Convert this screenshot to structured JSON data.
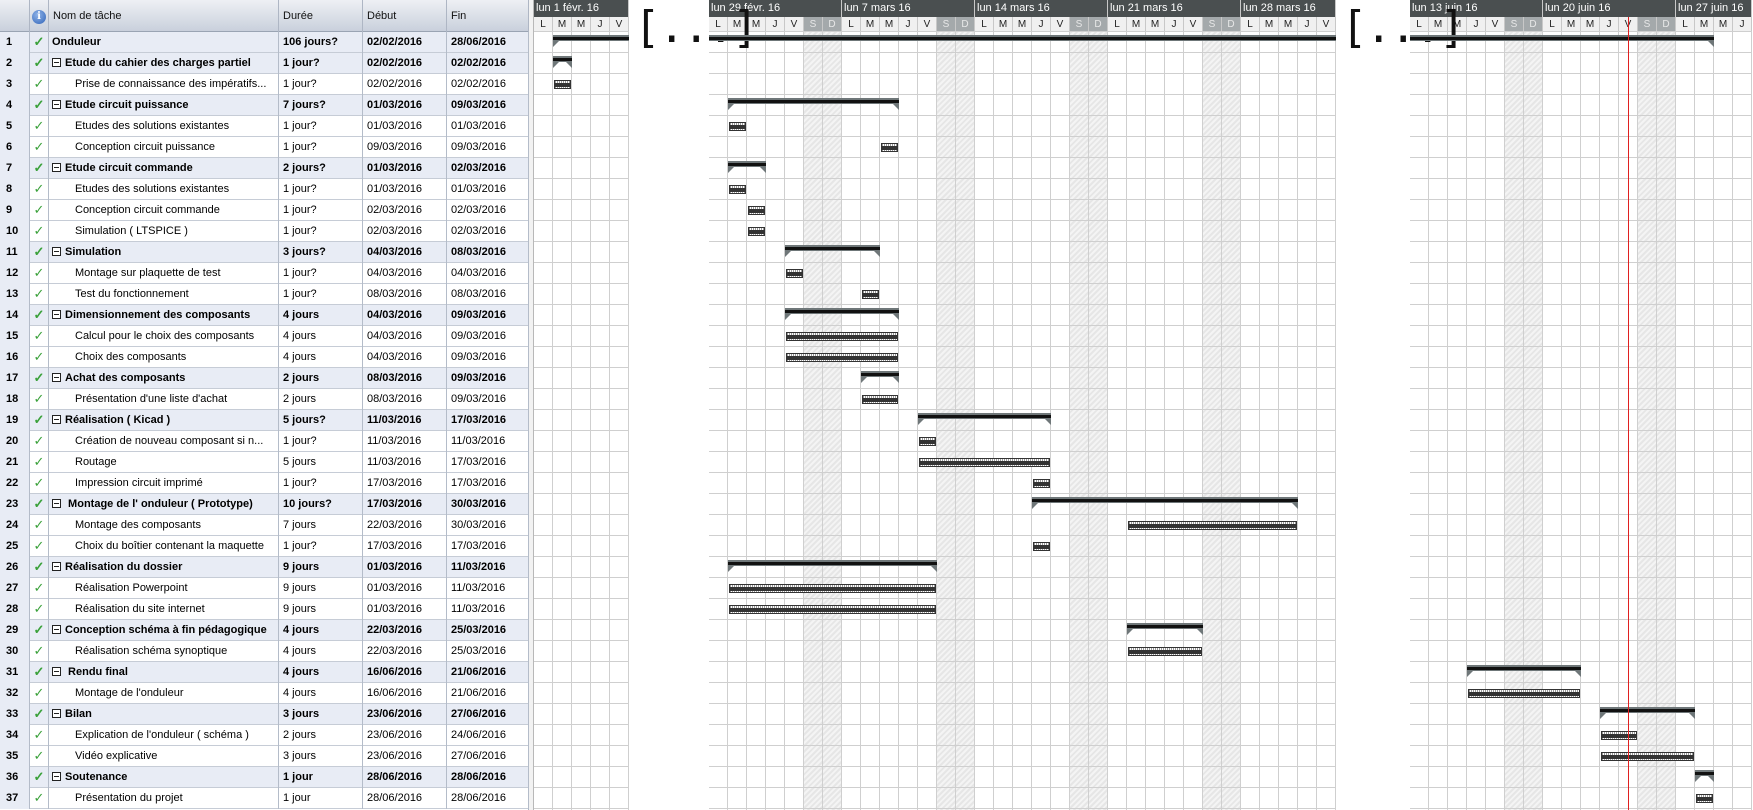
{
  "table": {
    "headers": {
      "id": "",
      "info_icon": "i",
      "name": "Nom de tâche",
      "duration": "Durée",
      "start": "Début",
      "end": "Fin"
    },
    "rows": [
      {
        "id": "1",
        "name": "Onduleur",
        "duration": "106 jours?",
        "start": "02/02/2016",
        "end": "28/06/2016",
        "summary": true,
        "level": 0,
        "collapsible": false,
        "done": true
      },
      {
        "id": "2",
        "name": "Etude du cahier des charges partiel",
        "duration": "1 jour?",
        "start": "02/02/2016",
        "end": "02/02/2016",
        "summary": true,
        "level": 1,
        "collapsible": true,
        "done": true
      },
      {
        "id": "3",
        "name": "Prise de connaissance des impératifs...",
        "duration": "1 jour?",
        "start": "02/02/2016",
        "end": "02/02/2016",
        "summary": false,
        "level": 2,
        "done": true
      },
      {
        "id": "4",
        "name": "Etude circuit puissance",
        "duration": "7 jours?",
        "start": "01/03/2016",
        "end": "09/03/2016",
        "summary": true,
        "level": 1,
        "collapsible": true,
        "done": true
      },
      {
        "id": "5",
        "name": "Etudes des solutions existantes",
        "duration": "1 jour?",
        "start": "01/03/2016",
        "end": "01/03/2016",
        "summary": false,
        "level": 2,
        "done": true
      },
      {
        "id": "6",
        "name": "Conception circuit puissance",
        "duration": "1 jour?",
        "start": "09/03/2016",
        "end": "09/03/2016",
        "summary": false,
        "level": 2,
        "done": true
      },
      {
        "id": "7",
        "name": "Etude circuit commande",
        "duration": "2 jours?",
        "start": "01/03/2016",
        "end": "02/03/2016",
        "summary": true,
        "level": 1,
        "collapsible": true,
        "done": true
      },
      {
        "id": "8",
        "name": "Etudes des solutions existantes",
        "duration": "1 jour?",
        "start": "01/03/2016",
        "end": "01/03/2016",
        "summary": false,
        "level": 2,
        "done": true
      },
      {
        "id": "9",
        "name": "Conception circuit commande",
        "duration": "1 jour?",
        "start": "02/03/2016",
        "end": "02/03/2016",
        "summary": false,
        "level": 2,
        "done": true
      },
      {
        "id": "10",
        "name": "Simulation ( LTSPICE )",
        "duration": "1 jour?",
        "start": "02/03/2016",
        "end": "02/03/2016",
        "summary": false,
        "level": 2,
        "done": true
      },
      {
        "id": "11",
        "name": "Simulation",
        "duration": "3 jours?",
        "start": "04/03/2016",
        "end": "08/03/2016",
        "summary": true,
        "level": 1,
        "collapsible": true,
        "done": true
      },
      {
        "id": "12",
        "name": "Montage sur plaquette de test",
        "duration": "1 jour?",
        "start": "04/03/2016",
        "end": "04/03/2016",
        "summary": false,
        "level": 2,
        "done": true
      },
      {
        "id": "13",
        "name": "Test du fonctionnement",
        "duration": "1 jour?",
        "start": "08/03/2016",
        "end": "08/03/2016",
        "summary": false,
        "level": 2,
        "done": true
      },
      {
        "id": "14",
        "name": "Dimensionnement des composants",
        "duration": "4 jours",
        "start": "04/03/2016",
        "end": "09/03/2016",
        "summary": true,
        "level": 1,
        "collapsible": true,
        "done": true
      },
      {
        "id": "15",
        "name": "Calcul pour le choix des composants",
        "duration": "4 jours",
        "start": "04/03/2016",
        "end": "09/03/2016",
        "summary": false,
        "level": 2,
        "done": true
      },
      {
        "id": "16",
        "name": "Choix des composants",
        "duration": "4 jours",
        "start": "04/03/2016",
        "end": "09/03/2016",
        "summary": false,
        "level": 2,
        "done": true
      },
      {
        "id": "17",
        "name": "Achat des composants",
        "duration": "2 jours",
        "start": "08/03/2016",
        "end": "09/03/2016",
        "summary": true,
        "level": 1,
        "collapsible": true,
        "done": true
      },
      {
        "id": "18",
        "name": "Présentation d'une liste d'achat",
        "duration": "2 jours",
        "start": "08/03/2016",
        "end": "09/03/2016",
        "summary": false,
        "level": 2,
        "done": true
      },
      {
        "id": "19",
        "name": "Réalisation ( Kicad )",
        "duration": "5 jours?",
        "start": "11/03/2016",
        "end": "17/03/2016",
        "summary": true,
        "level": 1,
        "collapsible": true,
        "done": true
      },
      {
        "id": "20",
        "name": "Création de nouveau composant si n...",
        "duration": "1 jour?",
        "start": "11/03/2016",
        "end": "11/03/2016",
        "summary": false,
        "level": 2,
        "done": true
      },
      {
        "id": "21",
        "name": "Routage",
        "duration": "5 jours",
        "start": "11/03/2016",
        "end": "17/03/2016",
        "summary": false,
        "level": 2,
        "done": true
      },
      {
        "id": "22",
        "name": "Impression circuit imprimé",
        "duration": "1 jour?",
        "start": "17/03/2016",
        "end": "17/03/2016",
        "summary": false,
        "level": 2,
        "done": true
      },
      {
        "id": "23",
        "name": " Montage de l' onduleur ( Prototype)",
        "duration": "10 jours?",
        "start": "17/03/2016",
        "end": "30/03/2016",
        "summary": true,
        "level": 1,
        "collapsible": true,
        "done": true
      },
      {
        "id": "24",
        "name": "Montage des composants",
        "duration": "7 jours",
        "start": "22/03/2016",
        "end": "30/03/2016",
        "summary": false,
        "level": 2,
        "done": true
      },
      {
        "id": "25",
        "name": "Choix du boîtier contenant la maquette",
        "duration": "1 jour?",
        "start": "17/03/2016",
        "end": "17/03/2016",
        "summary": false,
        "level": 2,
        "done": true
      },
      {
        "id": "26",
        "name": "Réalisation du dossier",
        "duration": "9 jours",
        "start": "01/03/2016",
        "end": "11/03/2016",
        "summary": true,
        "level": 1,
        "collapsible": true,
        "done": true
      },
      {
        "id": "27",
        "name": "Réalisation Powerpoint",
        "duration": "9 jours",
        "start": "01/03/2016",
        "end": "11/03/2016",
        "summary": false,
        "level": 2,
        "done": true
      },
      {
        "id": "28",
        "name": "Réalisation du site internet",
        "duration": "9 jours",
        "start": "01/03/2016",
        "end": "11/03/2016",
        "summary": false,
        "level": 2,
        "done": true
      },
      {
        "id": "29",
        "name": "Conception schéma à fin pédagogique",
        "duration": "4 jours",
        "start": "22/03/2016",
        "end": "25/03/2016",
        "summary": true,
        "level": 1,
        "collapsible": true,
        "done": true
      },
      {
        "id": "30",
        "name": "Réalisation schéma synoptique",
        "duration": "4 jours",
        "start": "22/03/2016",
        "end": "25/03/2016",
        "summary": false,
        "level": 2,
        "done": true
      },
      {
        "id": "31",
        "name": " Rendu final",
        "duration": "4 jours",
        "start": "16/06/2016",
        "end": "21/06/2016",
        "summary": true,
        "level": 1,
        "collapsible": true,
        "done": true
      },
      {
        "id": "32",
        "name": "Montage de l'onduleur",
        "duration": "4 jours",
        "start": "16/06/2016",
        "end": "21/06/2016",
        "summary": false,
        "level": 2,
        "done": true
      },
      {
        "id": "33",
        "name": "Bilan",
        "duration": "3 jours",
        "start": "23/06/2016",
        "end": "27/06/2016",
        "summary": true,
        "level": 1,
        "collapsible": true,
        "done": true
      },
      {
        "id": "34",
        "name": "Explication de l'onduleur ( schéma )",
        "duration": "2 jours",
        "start": "23/06/2016",
        "end": "24/06/2016",
        "summary": false,
        "level": 2,
        "done": true
      },
      {
        "id": "35",
        "name": "Vidéo explicative",
        "duration": "3 jours",
        "start": "23/06/2016",
        "end": "27/06/2016",
        "summary": false,
        "level": 2,
        "done": true
      },
      {
        "id": "36",
        "name": "Soutenance",
        "duration": "1 jour",
        "start": "28/06/2016",
        "end": "28/06/2016",
        "summary": true,
        "level": 1,
        "collapsible": true,
        "done": true
      },
      {
        "id": "37",
        "name": "Présentation du projet",
        "duration": "1 jour",
        "start": "28/06/2016",
        "end": "28/06/2016",
        "summary": false,
        "level": 2,
        "done": true
      }
    ]
  },
  "gantt": {
    "elision_marker": "[...]",
    "today": "24/06/2016",
    "colors": {
      "today_line": "#e02020",
      "header_dark": "#4a4f50",
      "weekend_header": "#a4a9ab",
      "done_check": "#3aa13a"
    },
    "day_letters": [
      "L",
      "M",
      "M",
      "J",
      "V",
      "S",
      "D"
    ],
    "sections": [
      {
        "weeks": [
          {
            "label": "lun 1 févr. 16",
            "start": "01/02/2016",
            "days": 5
          }
        ]
      },
      {
        "weeks": [
          {
            "label": "lun 29 févr. 16",
            "start": "29/02/2016",
            "days": 7
          },
          {
            "label": "lun 7 mars 16",
            "start": "07/03/2016",
            "days": 7
          },
          {
            "label": "lun 14 mars 16",
            "start": "14/03/2016",
            "days": 7
          },
          {
            "label": "lun 21 mars 16",
            "start": "21/03/2016",
            "days": 7
          },
          {
            "label": "lun 28 mars 16",
            "start": "28/03/2016",
            "days": 5
          }
        ]
      },
      {
        "weeks": [
          {
            "label": "lun 13 juin 16",
            "start": "13/06/2016",
            "days": 7
          },
          {
            "label": "lun 20 juin 16",
            "start": "20/06/2016",
            "days": 7
          },
          {
            "label": "lun 27 juin 16",
            "start": "27/06/2016",
            "days": 4
          }
        ]
      }
    ]
  }
}
